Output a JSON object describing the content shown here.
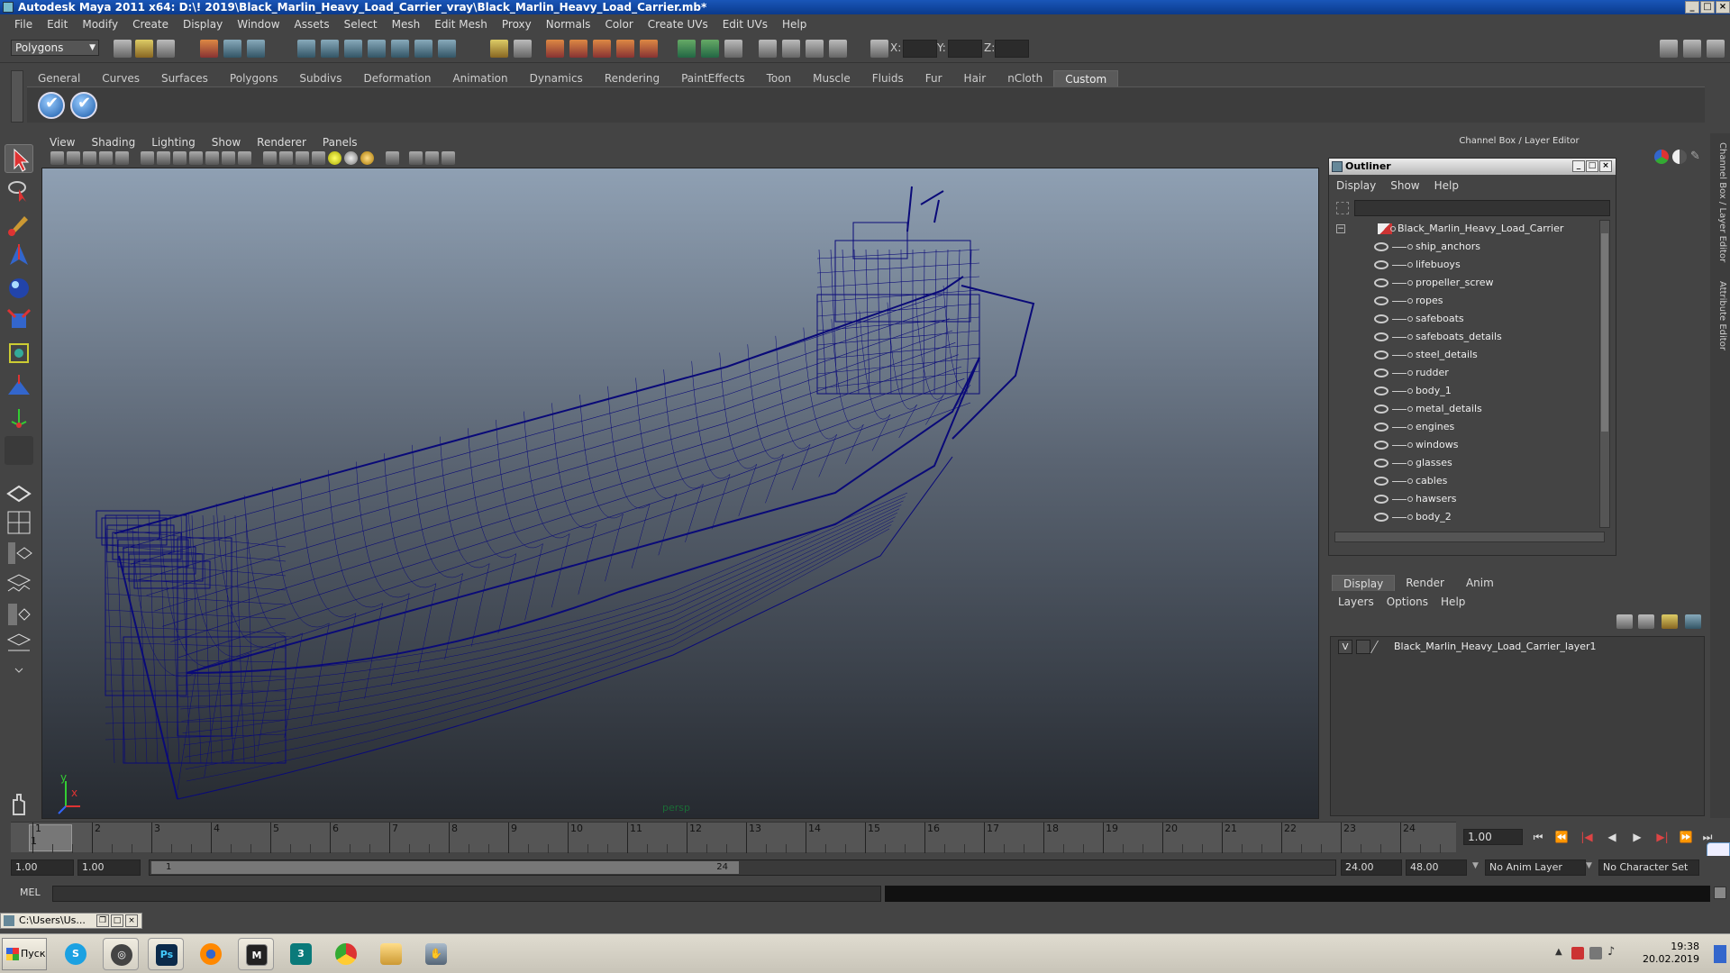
{
  "window": {
    "title": "Autodesk Maya 2011 x64: D:\\! 2019\\Black_Marlin_Heavy_Load_Carrier_vray\\Black_Marlin_Heavy_Load_Carrier.mb*"
  },
  "menubar": [
    "File",
    "Edit",
    "Modify",
    "Create",
    "Display",
    "Window",
    "Assets",
    "Select",
    "Mesh",
    "Edit Mesh",
    "Proxy",
    "Normals",
    "Color",
    "Create UVs",
    "Edit UVs",
    "Help"
  ],
  "status_line": {
    "mode": "Polygons",
    "x_label": "X:",
    "y_label": "Y:",
    "z_label": "Z:"
  },
  "shelf": {
    "tabs": [
      "General",
      "Curves",
      "Surfaces",
      "Polygons",
      "Subdivs",
      "Deformation",
      "Animation",
      "Dynamics",
      "Rendering",
      "PaintEffects",
      "Toon",
      "Muscle",
      "Fluids",
      "Fur",
      "Hair",
      "nCloth",
      "Custom"
    ],
    "active_tab": "Custom"
  },
  "viewport": {
    "menu": [
      "View",
      "Shading",
      "Lighting",
      "Show",
      "Renderer",
      "Panels"
    ],
    "camera_label": "persp",
    "axis_y": "y",
    "axis_x": "x",
    "wire_color": "#0a0a78"
  },
  "channel_box": {
    "header": "Channel Box / Layer Editor",
    "side_tab_1": "Channel Box / Layer Editor",
    "side_tab_2": "Attribute Editor"
  },
  "outliner": {
    "title": "Outliner",
    "menu": [
      "Display",
      "Show",
      "Help"
    ],
    "root": "Black_Marlin_Heavy_Load_Carrier",
    "items": [
      "ship_anchors",
      "lifebuoys",
      "propeller_screw",
      "ropes",
      "safeboats",
      "safeboats_details",
      "steel_details",
      "rudder",
      "body_1",
      "metal_details",
      "engines",
      "windows",
      "glasses",
      "cables",
      "hawsers",
      "body_2"
    ]
  },
  "layer_editor": {
    "tabs": [
      "Display",
      "Render",
      "Anim"
    ],
    "active_tab": "Display",
    "menu": [
      "Layers",
      "Options",
      "Help"
    ],
    "layer_visible": "V",
    "layer_name": "Black_Marlin_Heavy_Load_Carrier_layer1"
  },
  "timeline": {
    "ticks": [
      "1",
      "2",
      "3",
      "4",
      "5",
      "6",
      "7",
      "8",
      "9",
      "10",
      "11",
      "12",
      "13",
      "14",
      "15",
      "16",
      "17",
      "18",
      "19",
      "20",
      "21",
      "22",
      "23",
      "24"
    ],
    "playhead_label": "1",
    "current_frame": "1.00"
  },
  "range": {
    "start": "1.00",
    "playback_start": "1.00",
    "range_start_label": "1",
    "range_end_label": "24",
    "playback_end": "24.00",
    "end": "48.00",
    "anim_layer": "No Anim Layer",
    "character_set": "No Character Set"
  },
  "command_line": {
    "label": "MEL"
  },
  "minimized_window": {
    "title": "C:\\Users\\Us..."
  },
  "taskbar": {
    "start_label": "Пуск",
    "time": "19:38",
    "date": "20.02.2019",
    "ps_label": "Ps"
  }
}
